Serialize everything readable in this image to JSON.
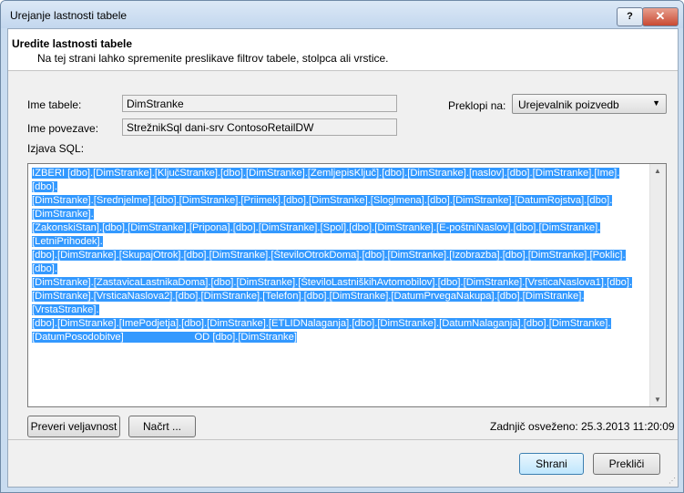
{
  "window": {
    "title": "Urejanje lastnosti tabele",
    "help_label": "?",
    "close_label": "✕"
  },
  "header": {
    "title": "Uredite lastnosti tabele",
    "description": "Na tej strani lahko spremenite preslikave filtrov tabele, stolpca ali vrstice."
  },
  "form": {
    "table_name_label": "Ime tabele:",
    "table_name_value": "DimStranke",
    "connection_label": "Ime povezave:",
    "connection_value": "StrežnikSql dani-srv ContosoRetailDW",
    "switch_label": "Preklopi na:",
    "switch_value": "Urejevalnik poizvedb",
    "sql_label": "Izjava SQL:"
  },
  "sql_lines": [
    "IZBERI [dbo].[DimStranke].[KljučStranke].[dbo].[DimStranke].[ZemljepisKljuč].[dbo].[DimStranke].[naslov].[dbo].[DimStranke].[Ime].[dbo].",
    "[DimStranke].[Srednjelme].[dbo].[DimStranke].[Priimek].[dbo].[DimStranke].[Sloglmena].[dbo].[DimStranke].[DatumRojstva].[dbo].[DimStranke].",
    "[ZakonskiStan].[dbo].[DimStranke].[Pripona].[dbo].[DimStranke].[Spol].[dbo].[DimStranke].[E-poštniNaslov].[dbo].[DimStranke].[LetniPrihodek].",
    "[dbo].[DimStranke].[SkupajOtrok].[dbo].[DimStranke].[ŠteviloOtrokDoma].[dbo].[DimStranke].[Izobrazba].[dbo].[DimStranke].[Poklic].[dbo].",
    "[DimStranke].[ZastavicaLastnikaDoma].[dbo].[DimStranke].[ŠteviloLastniškihAvtomobilov].[dbo].[DimStranke].[VrsticaNaslova1].[dbo].",
    "[DimStranke].[VrsticaNaslova2].[dbo].[DimStranke].[Telefon].[dbo].[DimStranke].[DatumPrvegaNakupa].[dbo].[DimStranke].[VrstaStranke].",
    "[dbo].[DimStranke].[ImePodjetja].[dbo].[DimStranke].[ETLIDNalaganja].[dbo].[DimStranke].[DatumNalaganja].[dbo].[DimStranke].",
    "[DatumPosodobitve]                         OD [dbo].[DimStranke]"
  ],
  "buttons": {
    "validate": "Preveri veljavnost",
    "design": "Načrt ...",
    "ok": "Shrani",
    "cancel": "Prekliči"
  },
  "status": {
    "last_refreshed": "Zadnjič osveženo: 25.3.2013 11:20:09"
  }
}
